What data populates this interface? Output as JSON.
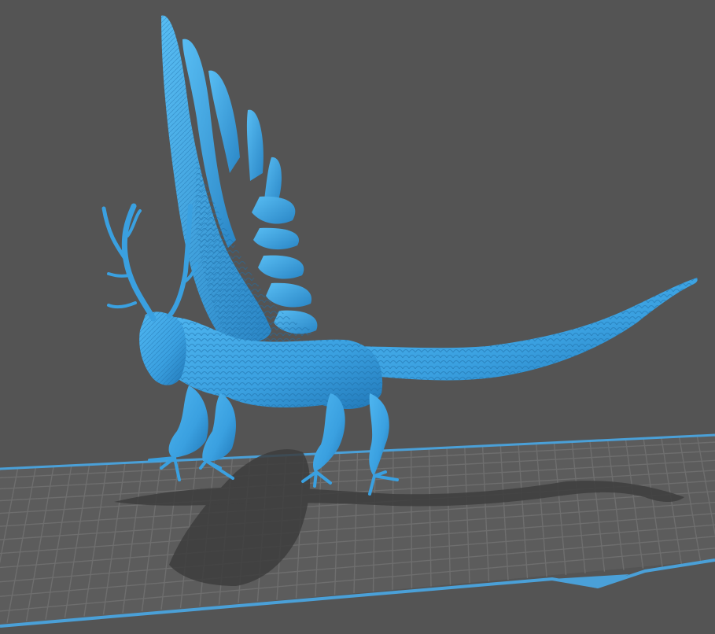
{
  "viewer": {
    "background_color": "#545454",
    "model": {
      "name": "",
      "color": "#3aa0e0",
      "shadow_color": "#3d3d3d",
      "description_icon": "winged-antlered-creature-model"
    },
    "build_plate": {
      "surface_color": "#5a5a5a",
      "grid_line_color": "#6e6e6e",
      "edge_color": "#4aa0d8"
    }
  }
}
